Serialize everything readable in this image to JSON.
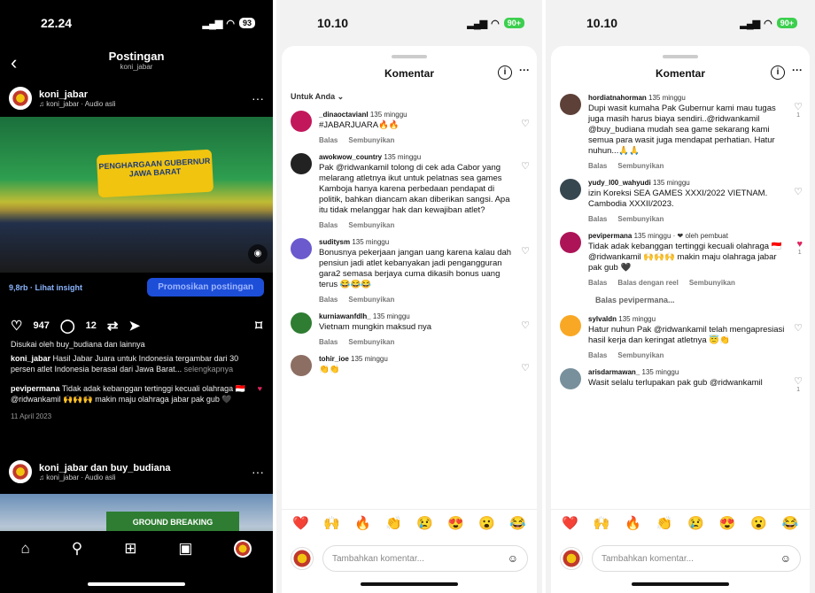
{
  "phone1": {
    "time": "22.24",
    "battery": "93",
    "title": "Postingan",
    "subtitle": "koni_jabar",
    "account": {
      "name": "koni_jabar",
      "audio": "♫ koni_jabar · Audio asli"
    },
    "banner_text": "PENGHARGAAN GUBERNUR JAWA BARAT",
    "insight": "9,8rb · Lihat insight",
    "promote": "Promosikan postingan",
    "likes": "947",
    "comments": "12",
    "liked_by": "Disukai oleh buy_budiana dan lainnya",
    "caption_user": "koni_jabar",
    "caption": "Hasil Jabar Juara untuk Indonesia tergambar dari 30 persen atlet Indonesia berasal dari Jawa Barat...",
    "caption_more": "selengkapnya",
    "comment_user": "pevipermana",
    "comment_text": "Tidak adak kebanggan tertinggi kecuali olahraga 🇮🇩 @ridwankamil 🙌🙌🙌 makin maju olahraga jabar pak gub 🖤",
    "date": "11 April 2023",
    "next_post": {
      "name": "koni_jabar dan buy_budiana",
      "audio": "♫ koni_jabar · Audio asli",
      "sign": "GROUND BREAKING"
    }
  },
  "phone2": {
    "time": "10.10",
    "battery": "90+",
    "title": "Komentar",
    "filter": "Untuk Anda ⌄",
    "reply": "Balas",
    "hide": "Sembunyikan",
    "input_placeholder": "Tambahkan komentar...",
    "emojis": [
      "❤️",
      "🙌",
      "🔥",
      "👏",
      "😢",
      "😍",
      "😮",
      "😂"
    ],
    "comments": [
      {
        "user": "_dinaoctavianl",
        "age": "135 minggu",
        "text": "#JABARJUARA🔥🔥",
        "color": "#c2185b"
      },
      {
        "user": "awokwow_country",
        "age": "135 minggu",
        "text": "Pak @ridwankamil tolong di cek ada Cabor yang melarang atletnya ikut untuk pelatnas sea games Kamboja hanya karena perbedaan pendapat di politik, bahkan diancam akan diberikan sangsi. Apa itu tidak melanggar hak dan kewajiban atlet?",
        "color": "#222"
      },
      {
        "user": "suditysm",
        "age": "135 minggu",
        "text": "Bonusnya pekerjaan jangan uang karena kalau dah pensiun jadi atlet kebanyakan jadi pengangguran gara2 semasa berjaya cuma dikasih bonus uang terus 😂😂😂",
        "color": "#6a5acd"
      },
      {
        "user": "kurniawanfdlh_",
        "age": "135 minggu",
        "text": "Vietnam mungkin maksud nya",
        "color": "#2e7d32"
      },
      {
        "user": "tohir_ioe",
        "age": "135 minggu",
        "text": "👏👏",
        "color": "#8d6e63"
      }
    ]
  },
  "phone3": {
    "time": "10.10",
    "battery": "90+",
    "title": "Komentar",
    "reply": "Balas",
    "hide": "Sembunyikan",
    "input_placeholder": "Tambahkan komentar...",
    "emojis": [
      "❤️",
      "🙌",
      "🔥",
      "👏",
      "😢",
      "😍",
      "😮",
      "😂"
    ],
    "comments": [
      {
        "user": "hordiatnahorman",
        "age": "135 minggu",
        "text": "Dupi wasit kumaha Pak Gubernur kami mau tugas juga masih harus biaya sendiri..@ridwankamil @buy_budiana mudah sea game sekarang kami semua para wasit juga mendapat perhatian. Hatur nuhun...🙏🙏",
        "likes": "1",
        "color": "#5d4037"
      },
      {
        "user": "yudy_l00_wahyudi",
        "age": "135 minggu",
        "text": "izin Koreksi SEA GAMES XXXI/2022 VIETNAM. Cambodia XXXII/2023.",
        "likes": "",
        "color": "#37474f"
      },
      {
        "user": "pevipermana",
        "age": "135 minggu · ❤ oleh pembuat",
        "text": "Tidak adak kebanggan tertinggi kecuali olahraga 🇮🇩 @ridwankamil 🙌🙌🙌 makin maju olahraga jabar pak gub 🖤",
        "likes": "1",
        "color": "#ad1457"
      },
      {
        "user": "sylvaldn",
        "age": "135 minggu",
        "text": "Hatur nuhun Pak @ridwankamil telah mengapresiasi hasil kerja dan keringat atletnya 😇👏",
        "likes": "",
        "color": "#f9a825"
      },
      {
        "user": "arisdarmawan_",
        "age": "135 minggu",
        "text": "Wasit selalu terlupakan pak gub @ridwankamil",
        "likes": "1",
        "color": "#78909c"
      }
    ],
    "reply_row": "Balas dengan reel",
    "view_replies": "Balas pevipermana..."
  }
}
